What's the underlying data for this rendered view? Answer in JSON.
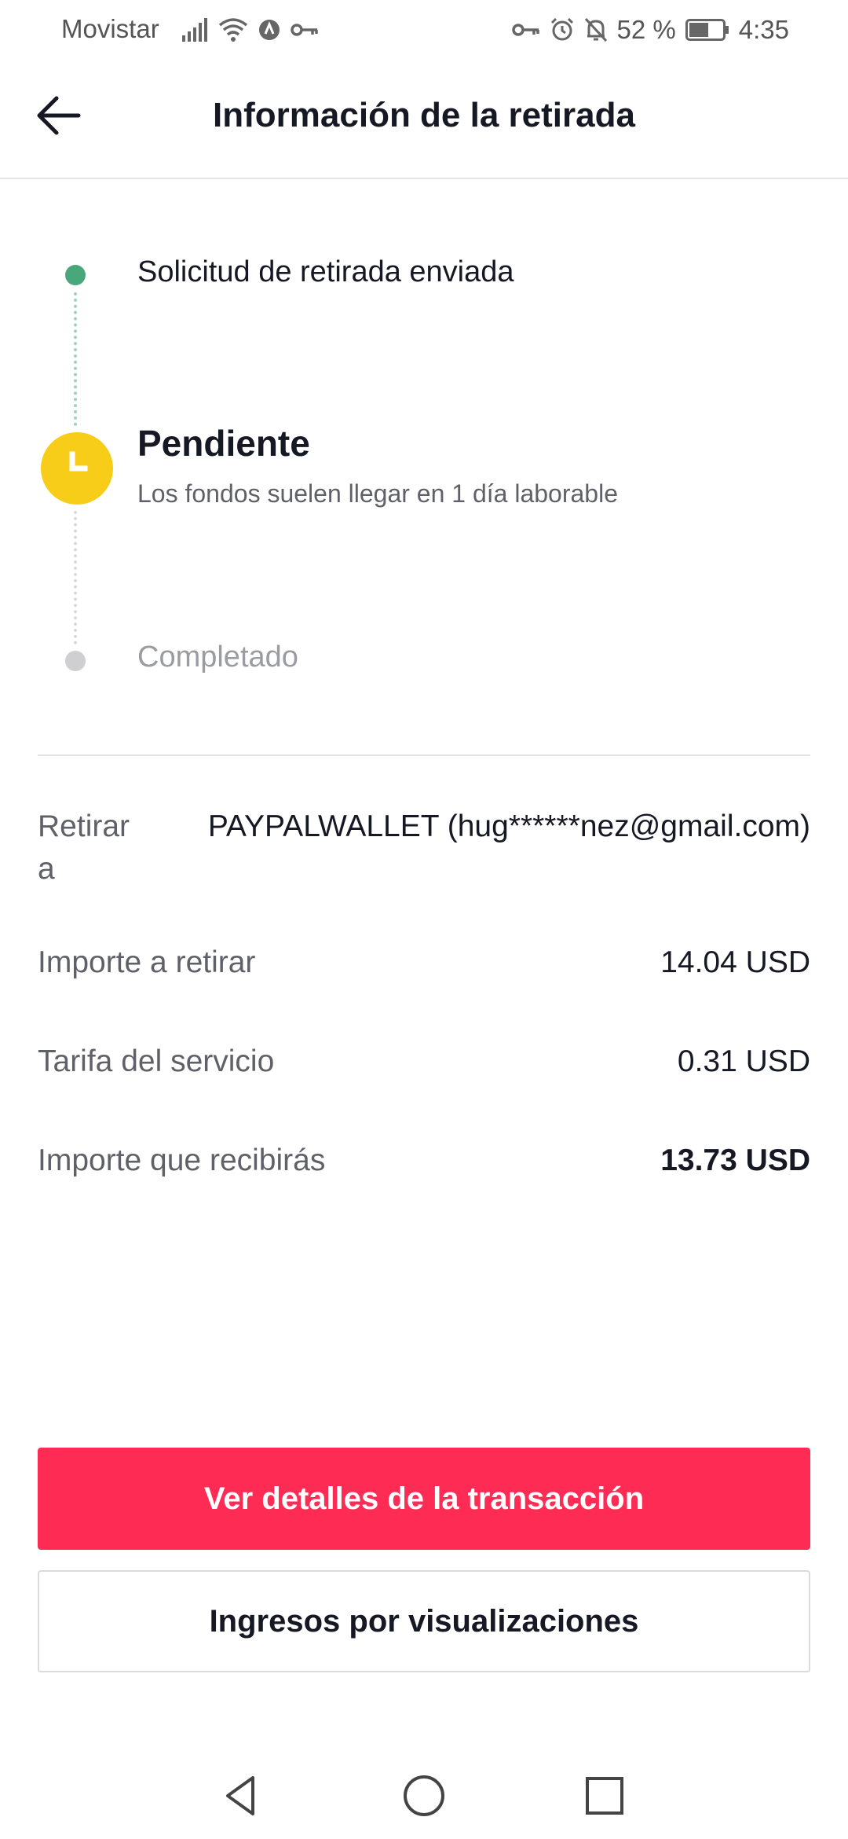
{
  "status_bar": {
    "carrier": "Movistar",
    "battery": "52 %",
    "time": "4:35",
    "icons_left": [
      "signal-icon",
      "wifi-icon",
      "data-saver-icon",
      "vpn-key-icon"
    ],
    "icons_right": [
      "vpn-key-icon",
      "alarm-icon",
      "notifications-off-icon",
      "battery-icon"
    ]
  },
  "header": {
    "title": "Información de la retirada",
    "back_icon": "back-arrow-icon"
  },
  "timeline": {
    "steps": [
      {
        "label": "Solicitud de retirada enviada",
        "status": "done"
      },
      {
        "label": "Pendiente",
        "description": "Los fondos suelen llegar en 1 día laborable",
        "status": "current"
      },
      {
        "label": "Completado",
        "status": "todo"
      }
    ],
    "colors": {
      "done": "#4aa77b",
      "current": "#f7cd1a",
      "todo": "#cfcfd2"
    }
  },
  "details": {
    "withdraw_to_label": "Retirar a",
    "withdraw_to_value": "PAYPALWALLET (hug******nez@gmail.com)",
    "amount_label": "Importe a retirar",
    "amount_value": "14.04 USD",
    "fee_label": "Tarifa del servicio",
    "fee_value": "0.31 USD",
    "receive_label": "Importe que recibirás",
    "receive_value": "13.73 USD"
  },
  "buttons": {
    "primary": "Ver detalles de la transacción",
    "secondary": "Ingresos por visualizaciones",
    "primary_color": "#fe2c55"
  },
  "navbar": {
    "icons": [
      "nav-back-icon",
      "nav-home-icon",
      "nav-recents-icon"
    ]
  }
}
